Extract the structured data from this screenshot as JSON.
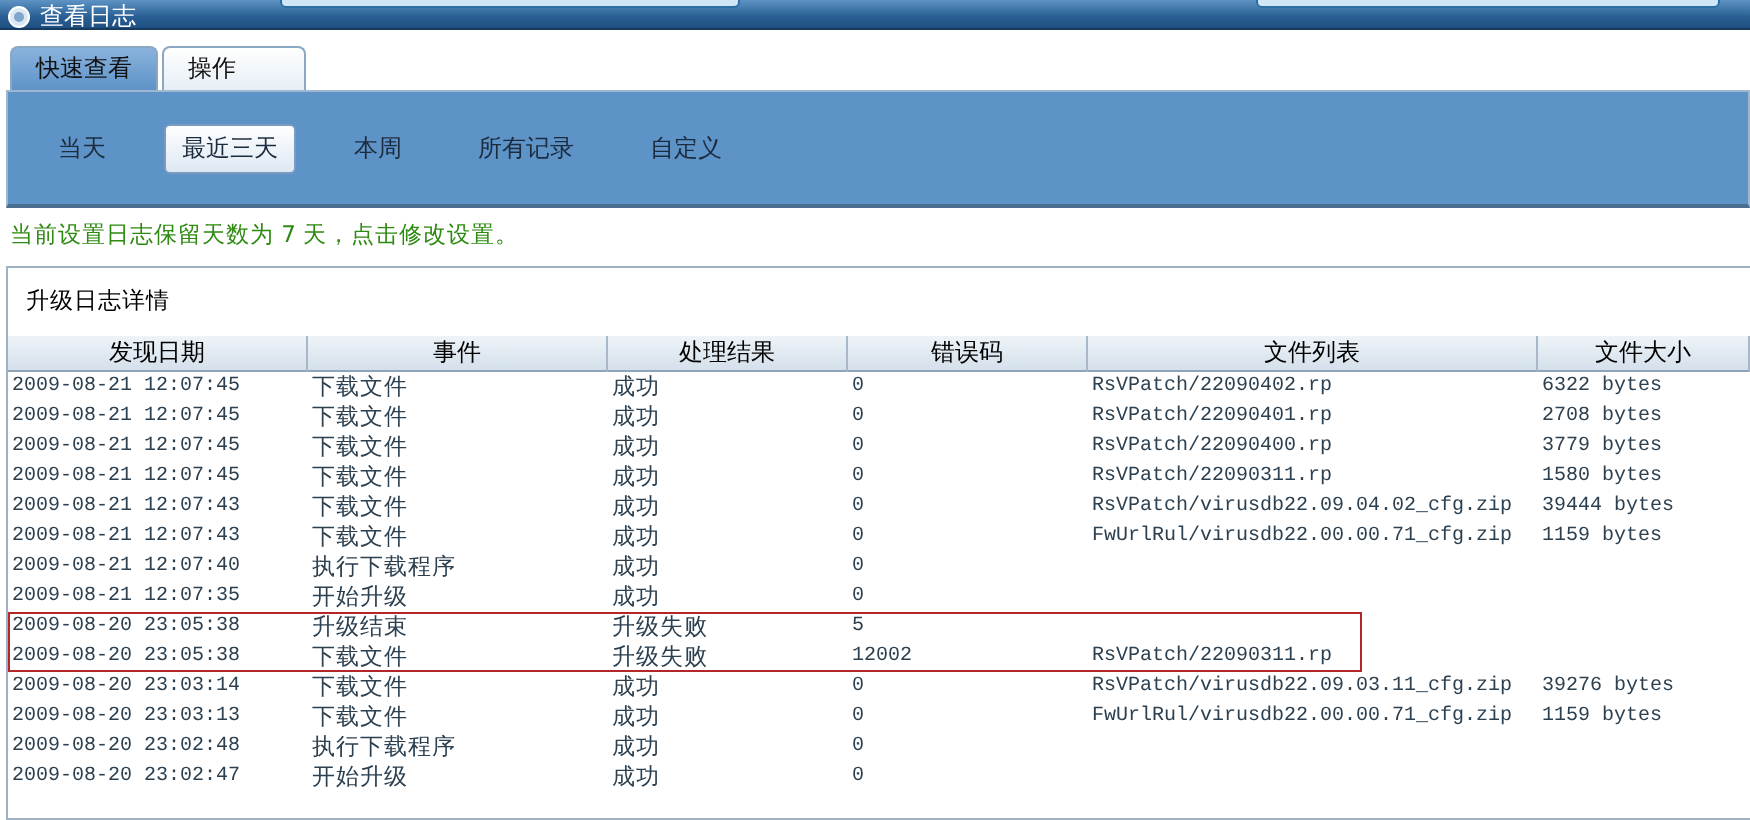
{
  "window": {
    "title": "查看日志"
  },
  "tabs": [
    {
      "label": "快速查看",
      "selected": true
    },
    {
      "label": "操作",
      "selected": false
    }
  ],
  "filters": [
    {
      "label": "当天",
      "selected": false
    },
    {
      "label": "最近三天",
      "selected": true
    },
    {
      "label": "本周",
      "selected": false
    },
    {
      "label": "所有记录",
      "selected": false
    },
    {
      "label": "自定义",
      "selected": false
    }
  ],
  "notice": "当前设置日志保留天数为 7 天，点击修改设置。",
  "panel": {
    "title": "升级日志详情"
  },
  "table": {
    "columns": [
      "发现日期",
      "事件",
      "处理结果",
      "错误码",
      "文件列表",
      "文件大小"
    ],
    "rows": [
      {
        "cells": [
          "2009-08-21 12:07:45",
          "下载文件",
          "成功",
          "0",
          "RsVPatch/22090402.rp",
          "6322 bytes"
        ],
        "highlighted": false
      },
      {
        "cells": [
          "2009-08-21 12:07:45",
          "下载文件",
          "成功",
          "0",
          "RsVPatch/22090401.rp",
          "2708 bytes"
        ],
        "highlighted": false
      },
      {
        "cells": [
          "2009-08-21 12:07:45",
          "下载文件",
          "成功",
          "0",
          "RsVPatch/22090400.rp",
          "3779 bytes"
        ],
        "highlighted": false
      },
      {
        "cells": [
          "2009-08-21 12:07:45",
          "下载文件",
          "成功",
          "0",
          "RsVPatch/22090311.rp",
          "1580 bytes"
        ],
        "highlighted": false
      },
      {
        "cells": [
          "2009-08-21 12:07:43",
          "下载文件",
          "成功",
          "0",
          "RsVPatch/virusdb22.09.04.02_cfg.zip",
          "39444 bytes"
        ],
        "highlighted": false
      },
      {
        "cells": [
          "2009-08-21 12:07:43",
          "下载文件",
          "成功",
          "0",
          "FwUrlRul/virusdb22.00.00.71_cfg.zip",
          "1159 bytes"
        ],
        "highlighted": false
      },
      {
        "cells": [
          "2009-08-21 12:07:40",
          "执行下载程序",
          "成功",
          "0",
          "",
          ""
        ],
        "highlighted": false
      },
      {
        "cells": [
          "2009-08-21 12:07:35",
          "开始升级",
          "成功",
          "0",
          "",
          ""
        ],
        "highlighted": false
      },
      {
        "cells": [
          "2009-08-20 23:05:38",
          "升级结束",
          "升级失败",
          "5",
          "",
          ""
        ],
        "highlighted": true
      },
      {
        "cells": [
          "2009-08-20 23:05:38",
          "下载文件",
          "升级失败",
          "12002",
          "RsVPatch/22090311.rp",
          ""
        ],
        "highlighted": true
      },
      {
        "cells": [
          "2009-08-20 23:03:14",
          "下载文件",
          "成功",
          "0",
          "RsVPatch/virusdb22.09.03.11_cfg.zip",
          "39276 bytes"
        ],
        "highlighted": false
      },
      {
        "cells": [
          "2009-08-20 23:03:13",
          "下载文件",
          "成功",
          "0",
          "FwUrlRul/virusdb22.00.00.71_cfg.zip",
          "1159 bytes"
        ],
        "highlighted": false
      },
      {
        "cells": [
          "2009-08-20 23:02:48",
          "执行下载程序",
          "成功",
          "0",
          "",
          ""
        ],
        "highlighted": false
      },
      {
        "cells": [
          "2009-08-20 23:02:47",
          "开始升级",
          "成功",
          "0",
          "",
          ""
        ],
        "highlighted": false
      }
    ]
  }
}
